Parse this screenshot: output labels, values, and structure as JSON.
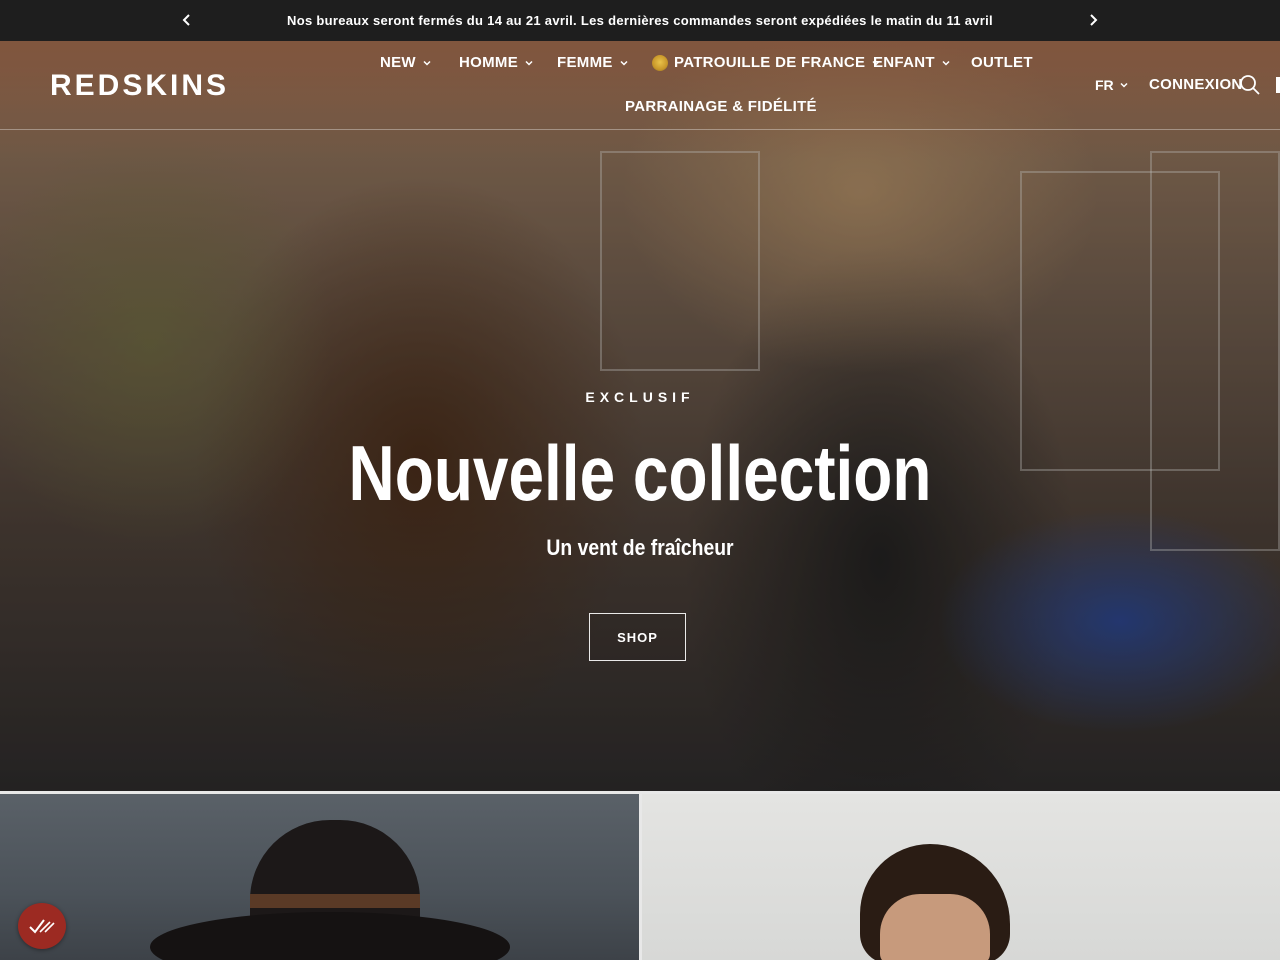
{
  "announcement": {
    "text": "Nos bureaux seront fermés du 14 au 21 avril. Les dernières commandes seront expédiées le matin du 11 avril"
  },
  "header": {
    "logo": "REDSKINS",
    "nav": [
      {
        "label": "NEW",
        "has_dropdown": true
      },
      {
        "label": "HOMME",
        "has_dropdown": true
      },
      {
        "label": "FEMME",
        "has_dropdown": true
      },
      {
        "label": "PATROUILLE DE FRANCE",
        "has_dropdown": true,
        "icon": "patrouille-badge-icon"
      },
      {
        "label": "ENFANT",
        "has_dropdown": true
      },
      {
        "label": "OUTLET",
        "has_dropdown": false
      },
      {
        "label": "PARRAINAGE & FIDÉLITÉ",
        "has_dropdown": false
      }
    ],
    "language": "FR",
    "login": "CONNEXION"
  },
  "hero": {
    "eyebrow": "EXCLUSIF",
    "title": "Nouvelle collection",
    "subtitle": "Un vent de fraîcheur",
    "cta": "SHOP"
  },
  "colors": {
    "announcement_bg": "#1e1e1e",
    "consent_badge": "#9c2a22"
  }
}
